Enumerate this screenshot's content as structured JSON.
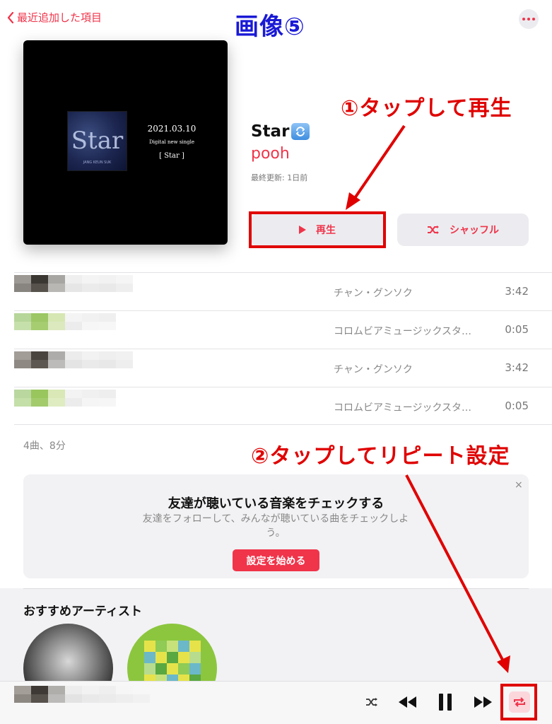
{
  "nav": {
    "back_label": "最近追加した項目"
  },
  "annotation": {
    "image_label": "画像⑤",
    "step1": "①タップして再生",
    "step2": "②タップしてリピート設定"
  },
  "cover": {
    "word": "Star",
    "date": "2021.03.10",
    "line2": "Digital new single",
    "line3": "[ Star ]",
    "small_text": "JANG KEUN SUK"
  },
  "album": {
    "title": "Star",
    "artist": "pooh",
    "updated": "最終更新: 1日前",
    "play_label": "再生",
    "shuffle_label": "シャッフル"
  },
  "tracks": [
    {
      "artist": "チャン・グンソク",
      "duration": "3:42"
    },
    {
      "artist": "コロムビアミュージックスタ…",
      "duration": "0:05"
    },
    {
      "artist": "チャン・グンソク",
      "duration": "3:42"
    },
    {
      "artist": "コロムビアミュージックスタ…",
      "duration": "0:05"
    }
  ],
  "summary": "4曲、8分",
  "friends_card": {
    "close": "×",
    "title": "友達が聴いている音楽をチェックする",
    "description": "友達をフォローして、みんなが聴いている曲をチェックしよう。",
    "button": "設定を始める"
  },
  "recommended": {
    "title": "おすすめアーティスト"
  },
  "colors": {
    "accent": "#f0344a",
    "annotation_red": "#e00000",
    "annotation_blue": "#1a1ad6"
  },
  "icons": {
    "back": "chevron-left-icon",
    "more": "ellipsis-icon",
    "play": "play-icon",
    "shuffle": "shuffle-icon",
    "repeat": "repeat-icon",
    "pause": "pause-icon",
    "rewind": "rewind-icon",
    "forward": "forward-icon"
  }
}
